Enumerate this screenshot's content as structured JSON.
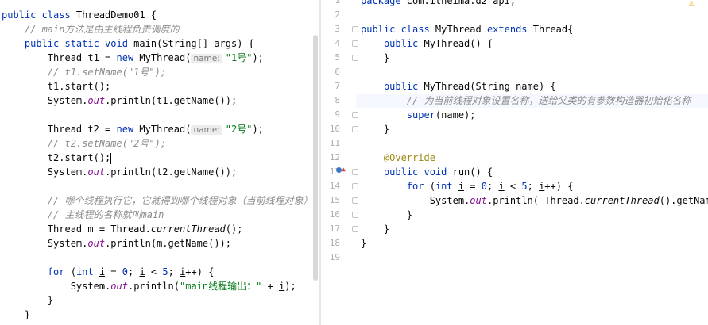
{
  "left_editor": {
    "lines": [
      [
        {
          "t": "public class ",
          "c": "kw"
        },
        {
          "t": "ThreadDemo01 {",
          "c": ""
        }
      ],
      [
        {
          "t": "    // main方法是由主线程负责调度的",
          "c": "cm"
        }
      ],
      [
        {
          "t": "    public static void ",
          "c": "kw"
        },
        {
          "t": "main(String[] args) {",
          "c": ""
        }
      ],
      [
        {
          "t": "        Thread t1 = ",
          "c": ""
        },
        {
          "t": "new ",
          "c": "kw"
        },
        {
          "t": "MyThread(",
          "c": ""
        },
        {
          "t": "name:",
          "c": "hint"
        },
        {
          "t": "\"1号\"",
          "c": "st"
        },
        {
          "t": ");",
          "c": ""
        }
      ],
      [
        {
          "t": "        // t1.setName(\"1号\");",
          "c": "cm"
        }
      ],
      [
        {
          "t": "        t1.start();",
          "c": ""
        }
      ],
      [
        {
          "t": "        System.",
          "c": ""
        },
        {
          "t": "out",
          "c": "fld"
        },
        {
          "t": ".println(t1.getName());",
          "c": ""
        }
      ],
      [
        {
          "t": "",
          "c": ""
        }
      ],
      [
        {
          "t": "        Thread t2 = ",
          "c": ""
        },
        {
          "t": "new ",
          "c": "kw"
        },
        {
          "t": "MyThread(",
          "c": ""
        },
        {
          "t": "name:",
          "c": "hint"
        },
        {
          "t": "\"2号\"",
          "c": "st"
        },
        {
          "t": ");",
          "c": ""
        }
      ],
      [
        {
          "t": "        // t2.setName(\"2号\");",
          "c": "cm"
        }
      ],
      [
        {
          "t": "        t2.start();",
          "c": ""
        },
        {
          "t": "",
          "c": "caret"
        }
      ],
      [
        {
          "t": "        System.",
          "c": ""
        },
        {
          "t": "out",
          "c": "fld"
        },
        {
          "t": ".println(t2.getName());",
          "c": ""
        }
      ],
      [
        {
          "t": "",
          "c": ""
        }
      ],
      [
        {
          "t": "        // 哪个线程执行它，它就得到哪个线程对象（当前线程对象）",
          "c": "cm"
        }
      ],
      [
        {
          "t": "        // 主线程的名称就叫main",
          "c": "cm"
        }
      ],
      [
        {
          "t": "        Thread m = Thread.",
          "c": ""
        },
        {
          "t": "currentThread",
          "c": "ital"
        },
        {
          "t": "();",
          "c": ""
        }
      ],
      [
        {
          "t": "        System.",
          "c": ""
        },
        {
          "t": "out",
          "c": "fld"
        },
        {
          "t": ".println(m.getName());",
          "c": ""
        }
      ],
      [
        {
          "t": "",
          "c": ""
        }
      ],
      [
        {
          "t": "        for ",
          "c": "kw"
        },
        {
          "t": "(",
          "c": ""
        },
        {
          "t": "int ",
          "c": "kw"
        },
        {
          "t": "i",
          "c": "ul"
        },
        {
          "t": " = ",
          "c": ""
        },
        {
          "t": "0",
          "c": "kw"
        },
        {
          "t": "; ",
          "c": ""
        },
        {
          "t": "i",
          "c": "ul"
        },
        {
          "t": " < ",
          "c": ""
        },
        {
          "t": "5",
          "c": "kw"
        },
        {
          "t": "; ",
          "c": ""
        },
        {
          "t": "i",
          "c": "ul"
        },
        {
          "t": "++) {",
          "c": ""
        }
      ],
      [
        {
          "t": "            System.",
          "c": ""
        },
        {
          "t": "out",
          "c": "fld"
        },
        {
          "t": ".println(",
          "c": ""
        },
        {
          "t": "\"main线程输出：\"",
          "c": "st"
        },
        {
          "t": " + ",
          "c": ""
        },
        {
          "t": "i",
          "c": "ul"
        },
        {
          "t": ");",
          "c": ""
        }
      ],
      [
        {
          "t": "        }",
          "c": ""
        }
      ],
      [
        {
          "t": "    }",
          "c": ""
        }
      ]
    ]
  },
  "right_editor": {
    "line_numbers": [
      "1",
      "2",
      "3",
      "4",
      "5",
      "6",
      "7",
      "8",
      "9",
      "10",
      "11",
      "12",
      "13",
      "14",
      "15",
      "16",
      "17",
      "18",
      "19"
    ],
    "lines": [
      [
        {
          "t": "package ",
          "c": "kw"
        },
        {
          "t": "com.itheima.d2_api;",
          "c": ""
        }
      ],
      [
        {
          "t": "",
          "c": ""
        }
      ],
      [
        {
          "t": "public class ",
          "c": "kw"
        },
        {
          "t": "MyThread ",
          "c": ""
        },
        {
          "t": "extends ",
          "c": "kw"
        },
        {
          "t": "Thread{",
          "c": ""
        }
      ],
      [
        {
          "t": "    public ",
          "c": "kw"
        },
        {
          "t": "MyThread() {",
          "c": ""
        }
      ],
      [
        {
          "t": "    }",
          "c": ""
        }
      ],
      [
        {
          "t": "",
          "c": ""
        }
      ],
      [
        {
          "t": "    public ",
          "c": "kw"
        },
        {
          "t": "MyThread(String name) {",
          "c": ""
        }
      ],
      [
        {
          "t": "        // 为当前线程对象设置名称，送给父类的有参数构造器初始化名称",
          "c": "cm"
        }
      ],
      [
        {
          "t": "        super",
          "c": "kw"
        },
        {
          "t": "(name);",
          "c": ""
        }
      ],
      [
        {
          "t": "    }",
          "c": ""
        }
      ],
      [
        {
          "t": "",
          "c": ""
        }
      ],
      [
        {
          "t": "    @Override",
          "c": "ann"
        }
      ],
      [
        {
          "t": "    public void ",
          "c": "kw"
        },
        {
          "t": "run() {",
          "c": ""
        }
      ],
      [
        {
          "t": "        for ",
          "c": "kw"
        },
        {
          "t": "(",
          "c": ""
        },
        {
          "t": "int ",
          "c": "kw"
        },
        {
          "t": "i",
          "c": "ul"
        },
        {
          "t": " = ",
          "c": ""
        },
        {
          "t": "0",
          "c": "kw"
        },
        {
          "t": "; ",
          "c": ""
        },
        {
          "t": "i",
          "c": "ul"
        },
        {
          "t": " < ",
          "c": ""
        },
        {
          "t": "5",
          "c": "kw"
        },
        {
          "t": "; ",
          "c": ""
        },
        {
          "t": "i",
          "c": "ul"
        },
        {
          "t": "++) {",
          "c": ""
        }
      ],
      [
        {
          "t": "            System.",
          "c": ""
        },
        {
          "t": "out",
          "c": "fld"
        },
        {
          "t": ".println( Thread.",
          "c": ""
        },
        {
          "t": "currentThread",
          "c": "ital"
        },
        {
          "t": "().getName() + ",
          "c": ""
        }
      ],
      [
        {
          "t": "        }",
          "c": ""
        }
      ],
      [
        {
          "t": "    }",
          "c": ""
        }
      ],
      [
        {
          "t": "}",
          "c": ""
        }
      ],
      [
        {
          "t": "",
          "c": ""
        }
      ]
    ]
  },
  "warning_icon": "warning-icon",
  "breakpoint_icon": "override-gutter-icon"
}
